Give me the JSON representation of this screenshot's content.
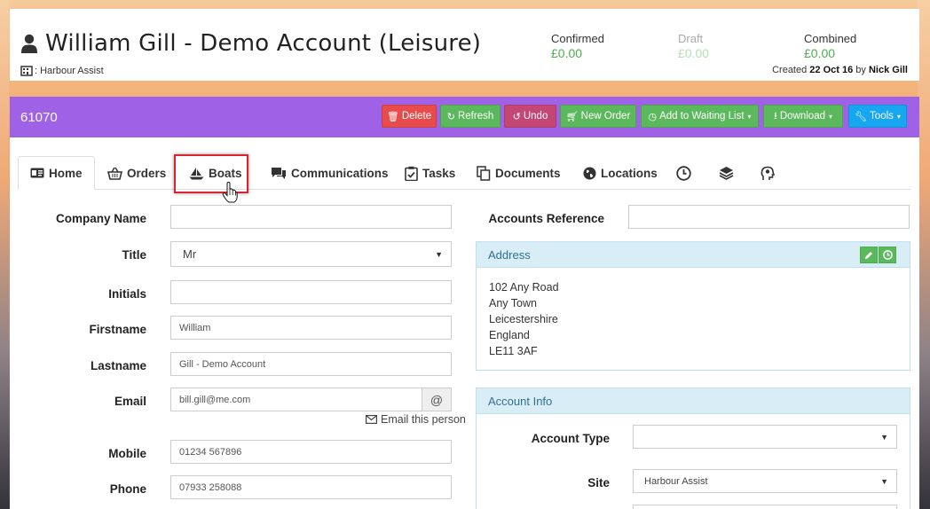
{
  "header": {
    "title": "William Gill - Demo Account (Leisure)",
    "site_label": ": Harbour Assist",
    "totals": [
      {
        "label": "Confirmed",
        "amount": "£0.00"
      },
      {
        "label": "Draft",
        "amount": "£0.00"
      },
      {
        "label": "Combined",
        "amount": "£0.00"
      }
    ],
    "created_prefix": "Created",
    "created_date": "22 Oct 16",
    "created_by_word": "by",
    "created_by": "Nick Gill"
  },
  "account_bar": {
    "id": "61070",
    "buttons": {
      "delete": "Delete",
      "refresh": "Refresh",
      "undo": "Undo",
      "new_order": "New Order",
      "waiting_list": "Add to Waiting List",
      "download": "Download",
      "tools": "Tools"
    }
  },
  "tabs": {
    "home": "Home",
    "orders": "Orders",
    "boats": "Boats",
    "communications": "Communications",
    "tasks": "Tasks",
    "documents": "Documents",
    "locations": "Locations"
  },
  "form": {
    "company_name": {
      "label": "Company Name",
      "value": ""
    },
    "title": {
      "label": "Title",
      "value": "Mr"
    },
    "initials": {
      "label": "Initials",
      "value": ""
    },
    "firstname": {
      "label": "Firstname",
      "value": "William"
    },
    "lastname": {
      "label": "Lastname",
      "value": "Gill - Demo Account"
    },
    "email": {
      "label": "Email",
      "value": "bill.gill@me.com",
      "addon": "@",
      "link": "Email this person"
    },
    "mobile": {
      "label": "Mobile",
      "value": "01234 567896"
    },
    "phone": {
      "label": "Phone",
      "value": "07933 258088"
    },
    "accounts_reference": {
      "label": "Accounts Reference",
      "value": ""
    }
  },
  "address": {
    "heading": "Address",
    "lines": [
      "102 Any Road",
      "Any Town",
      "Leicestershire",
      "England",
      "LE11 3AF"
    ]
  },
  "account_info": {
    "heading": "Account Info",
    "account_type": {
      "label": "Account Type",
      "value": ""
    },
    "site": {
      "label": "Site",
      "value": "Harbour Assist"
    }
  },
  "colors": {
    "accent_purple": "#9f62e6",
    "green": "#5cb85c",
    "red": "#e84b4b",
    "pink": "#c44674",
    "blue": "#17a6ef",
    "highlight": "#d9232e"
  }
}
